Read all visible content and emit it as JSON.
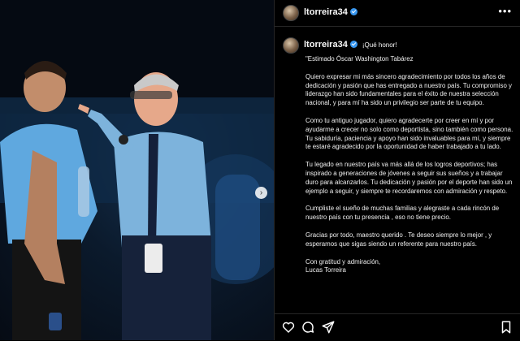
{
  "post": {
    "username": "ltorreira34",
    "more_icon": "more-horizontal-icon",
    "caption": {
      "title": "¡Qué honor!",
      "paragraphs": [
        "\"Estimado Óscar Washington Tabárez",
        "Quiero expresar mi más sincero agradecimiento por todos los años de dedicación y pasión que has entregado a nuestro país. Tu compromiso y liderazgo han sido fundamentales para el éxito de nuestra selección nacional, y para mí ha sido un privilegio ser parte de tu equipo.",
        "Como tu antiguo jugador, quiero agradecerte por creer en mí y por ayudarme a crecer no solo como deportista, sino también como persona. Tu sabiduría, paciencia y apoyo han sido invaluables para mí, y siempre te estaré agradecido por la oportunidad de haber trabajado a tu lado.",
        "Tu legado en nuestro país va más allá de los logros deportivos; has inspirado a generaciones de jóvenes a seguir sus sueños y a trabajar duro para alcanzarlos. Tu dedicación y pasión por el deporte han sido un ejemplo a seguir, y siempre te recordaremos con admiración y respeto.",
        "Cumpliste el sueño de muchas familias y alegraste a cada rincón de nuestro país con tu presencia , eso no tiene precio.",
        "Gracias por todo, maestro querido . Te deseo siempre lo mejor , y esperamos que sigas siendo un referente para nuestro país."
      ],
      "signoff": "Con gratitud y admiración,",
      "signature": "Lucas Torreira"
    },
    "actions": {
      "like_icon": "heart-icon",
      "comment_icon": "comment-icon",
      "share_icon": "share-icon",
      "save_icon": "bookmark-icon"
    },
    "carousel": {
      "next_icon": "chevron-right-icon"
    },
    "colors": {
      "verified": "#3897f0",
      "background": "#000000",
      "uruguay_blue": "#5fa8df"
    }
  }
}
